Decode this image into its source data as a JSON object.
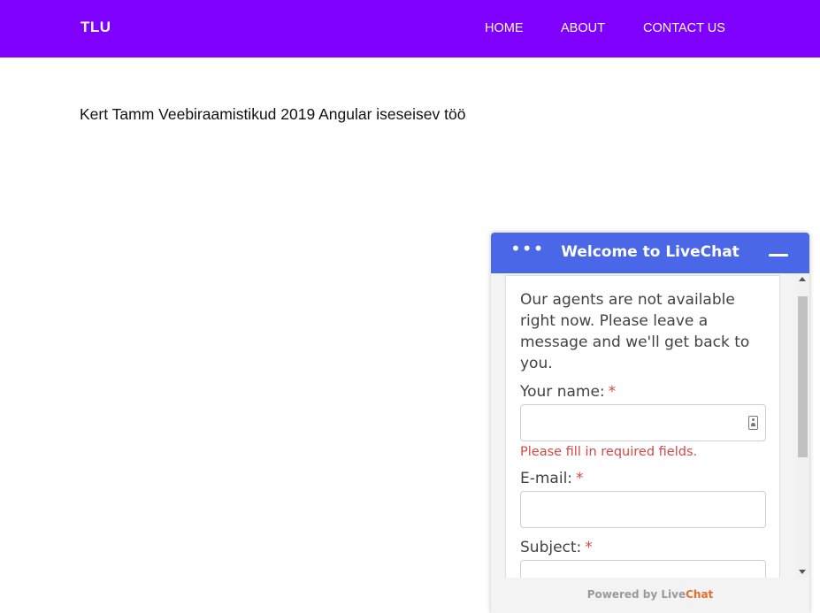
{
  "navbar": {
    "brand": "TLU",
    "links": [
      "HOME",
      "ABOUT",
      "CONTACT US"
    ]
  },
  "main": {
    "intro_text": "Kert Tamm Veebiraamistikud 2019 Angular iseseisev töö"
  },
  "chat": {
    "menu_glyph": "•••",
    "title": "Welcome to LiveChat",
    "message": "Our agents are not available right now. Please leave a message and we'll get back to you.",
    "fields": [
      {
        "label": "Your name:",
        "required_mark": "*"
      },
      {
        "label": "E-mail:",
        "required_mark": "*"
      },
      {
        "label": "Subject:",
        "required_mark": "*"
      }
    ],
    "error": "Please fill in required fields.",
    "footer_prefix": "Powered by ",
    "footer_brand_a": "Live",
    "footer_brand_b": "Chat"
  },
  "colors": {
    "navbar_bg": "#7f00ff",
    "chat_header_bg": "#4a67e8",
    "error": "#d64646",
    "footer_accent": "#e0712c"
  },
  "icons": {
    "menu": "ellipsis-icon",
    "minimize": "minimize-icon",
    "name_field": "contact-card-icon"
  }
}
